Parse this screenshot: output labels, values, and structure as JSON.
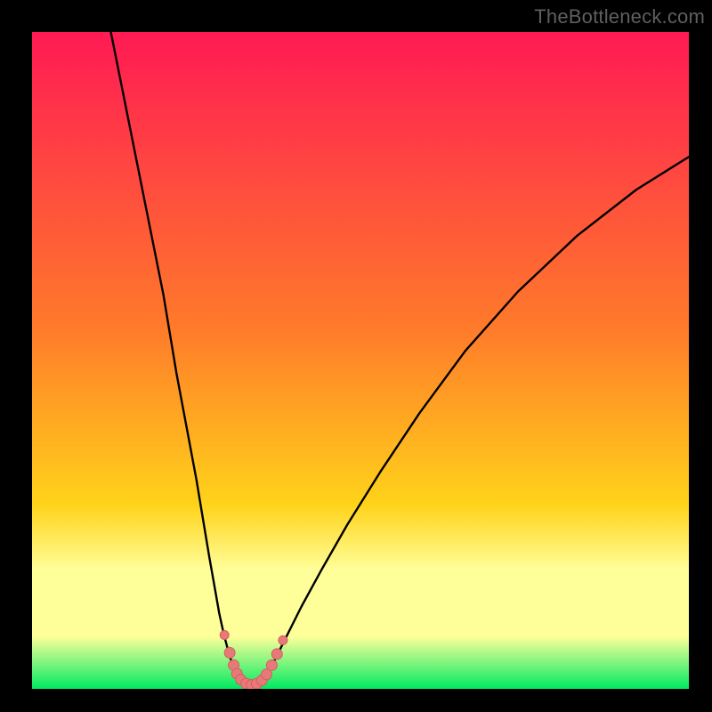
{
  "watermark": "TheBottleneck.com",
  "colors": {
    "frame": "#000000",
    "watermark_text": "#5f5f5f",
    "gradient_top": "#ff1a54",
    "gradient_mid1": "#ff7a2a",
    "gradient_mid2": "#ffd31a",
    "gradient_band": "#ffff9a",
    "gradient_bottom": "#00ea62",
    "curve_stroke": "#000000",
    "marker_fill": "#e67a7a",
    "marker_stroke": "#d85c5c"
  },
  "chart_data": {
    "type": "line",
    "title": "",
    "xlabel": "",
    "ylabel": "",
    "xlim": [
      0,
      100
    ],
    "ylim": [
      0,
      100
    ],
    "series": [
      {
        "name": "left-branch",
        "x": [
          12.0,
          14.0,
          16.0,
          18.0,
          20.0,
          22.0,
          23.5,
          25.0,
          26.0,
          27.0,
          27.8,
          28.5,
          29.2,
          30.0,
          30.5,
          31.0,
          31.5
        ],
        "y": [
          100.0,
          90.0,
          80.0,
          70.0,
          60.0,
          48.0,
          40.0,
          32.0,
          26.0,
          20.0,
          15.5,
          11.5,
          8.3,
          5.3,
          3.8,
          2.7,
          1.8
        ]
      },
      {
        "name": "right-branch",
        "x": [
          35.5,
          36.5,
          37.5,
          39.0,
          41.0,
          44.0,
          48.0,
          53.0,
          59.0,
          66.0,
          74.0,
          83.0,
          92.0,
          100.0
        ],
        "y": [
          1.8,
          3.5,
          5.5,
          8.5,
          12.5,
          18.0,
          25.0,
          33.0,
          42.0,
          51.5,
          60.5,
          69.0,
          76.0,
          81.0
        ]
      },
      {
        "name": "valley-floor",
        "x": [
          31.5,
          32.5,
          33.5,
          34.5,
          35.5
        ],
        "y": [
          1.8,
          0.7,
          0.5,
          0.7,
          1.8
        ]
      }
    ],
    "markers": [
      {
        "x": 29.3,
        "y": 8.2,
        "r": 5
      },
      {
        "x": 30.1,
        "y": 5.5,
        "r": 6
      },
      {
        "x": 30.7,
        "y": 3.6,
        "r": 6
      },
      {
        "x": 31.2,
        "y": 2.3,
        "r": 6
      },
      {
        "x": 31.8,
        "y": 1.4,
        "r": 6
      },
      {
        "x": 32.6,
        "y": 0.8,
        "r": 6
      },
      {
        "x": 33.4,
        "y": 0.6,
        "r": 6
      },
      {
        "x": 34.2,
        "y": 0.8,
        "r": 6
      },
      {
        "x": 35.0,
        "y": 1.3,
        "r": 6
      },
      {
        "x": 35.7,
        "y": 2.2,
        "r": 6
      },
      {
        "x": 36.5,
        "y": 3.6,
        "r": 6
      },
      {
        "x": 37.3,
        "y": 5.3,
        "r": 6
      },
      {
        "x": 38.2,
        "y": 7.4,
        "r": 5
      }
    ],
    "gradient_stops_y_pct": {
      "top": 0,
      "mid1": 45,
      "mid2": 72,
      "band_top": 82,
      "band_bottom": 92,
      "bottom": 100
    }
  }
}
